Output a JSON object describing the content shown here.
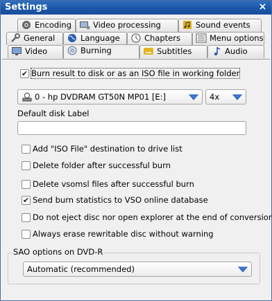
{
  "window": {
    "title": "Settings",
    "close_glyph": "×"
  },
  "tabs": {
    "row1": [
      {
        "label": "Encoding",
        "icon": "encoding-icon"
      },
      {
        "label": "Video processing",
        "icon": "video-processing-icon"
      },
      {
        "label": "Sound events",
        "icon": "sound-events-icon"
      }
    ],
    "row2": [
      {
        "label": "General",
        "icon": "wrench-icon"
      },
      {
        "label": "Language",
        "icon": "globe-icon"
      },
      {
        "label": "Chapters",
        "icon": "clock-icon"
      },
      {
        "label": "Menu options",
        "icon": "menu-options-icon"
      }
    ],
    "row3": [
      {
        "label": "Video",
        "icon": "monitor-icon"
      },
      {
        "label": "Burning",
        "icon": "disc-icon",
        "active": true
      },
      {
        "label": "Subtitles",
        "icon": "subtitles-icon"
      },
      {
        "label": "Audio",
        "icon": "music-note-icon"
      }
    ]
  },
  "burning": {
    "burn_result": {
      "label": "Burn result to disk or as an ISO file in working folder",
      "checked": true
    },
    "drive": {
      "value": "0 - hp DVDRAM GT50N MP01 [E:]",
      "icon": "drive-icon"
    },
    "speed": {
      "value": "4x"
    },
    "disk_label": {
      "label": "Default disk Label",
      "value": ""
    },
    "options": [
      {
        "label": "Add \"ISO File\" destination to drive list",
        "checked": false
      },
      {
        "label": "Delete folder after successful burn",
        "checked": false
      },
      {
        "label": "Delete vsomsl files after successful burn",
        "checked": false
      },
      {
        "label": "Send burn statistics to VSO online database",
        "checked": true
      },
      {
        "label": "Do not eject disc nor open explorer at the end of conversion",
        "checked": false
      },
      {
        "label": "Always erase rewritable disc without warning",
        "checked": false
      }
    ],
    "sao": {
      "group_title": "SAO options on DVD-R",
      "value": "Automatic (recommended)"
    }
  },
  "colors": {
    "titlebar": "#1a56a8",
    "arrow": "#3a78d8",
    "check": "#222222"
  }
}
